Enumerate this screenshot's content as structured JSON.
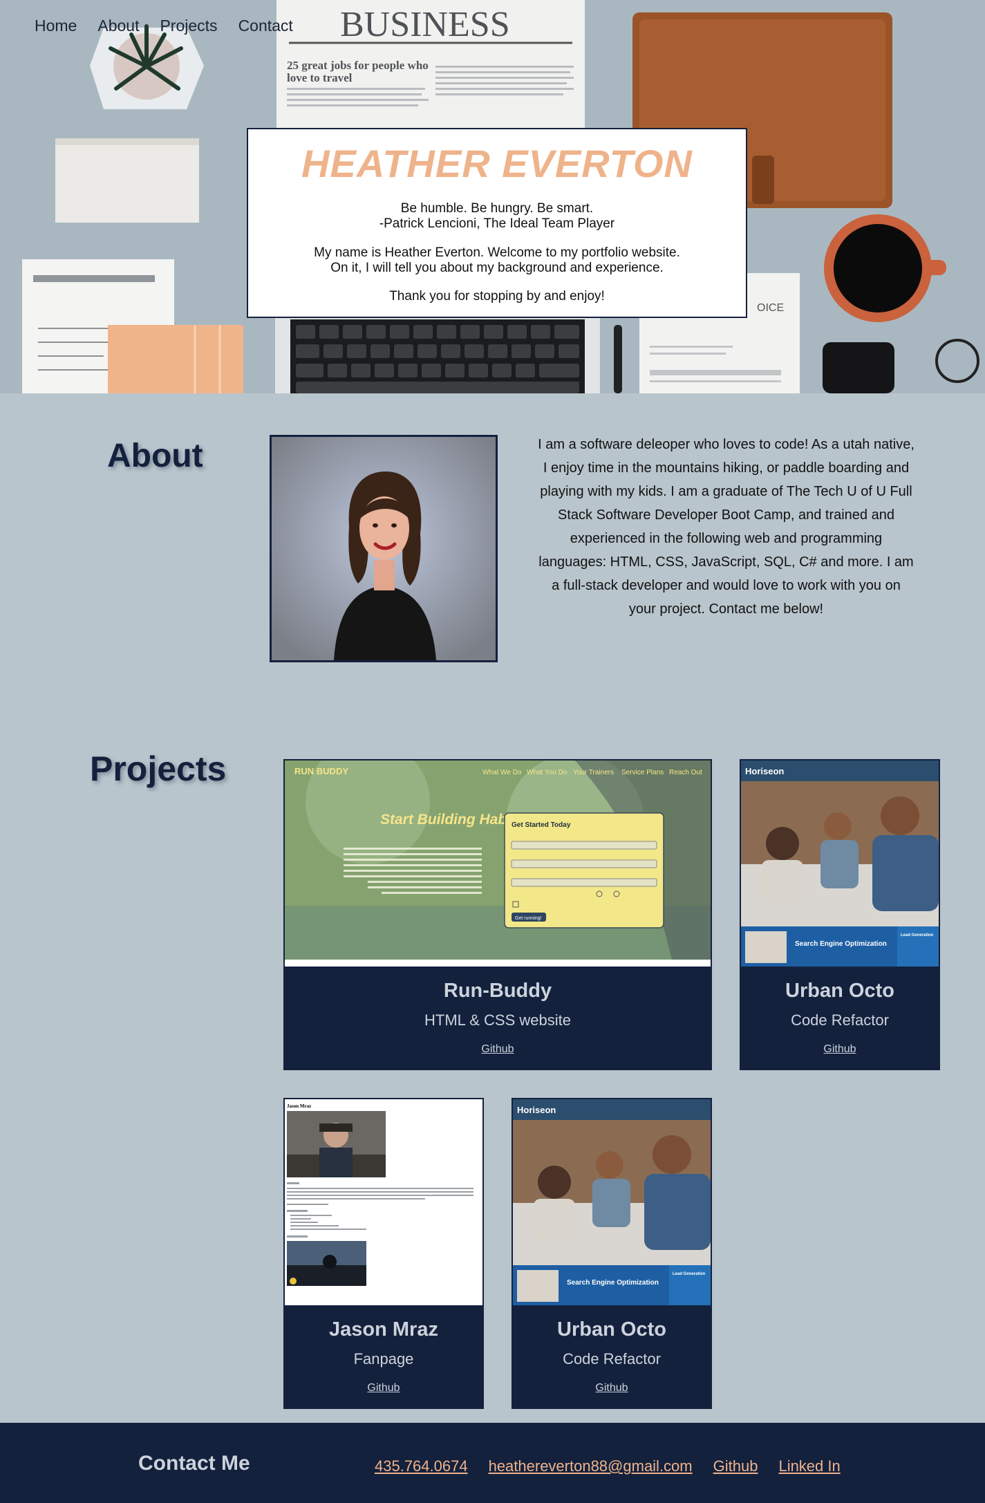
{
  "nav": {
    "items": [
      "Home",
      "About",
      "Projects",
      "Contact"
    ]
  },
  "hero": {
    "newspaper_masthead": "BUSINESS",
    "newspaper_headline": "25 great jobs for people who love to travel",
    "name": "HEATHER EVERTON",
    "quote_line1": "Be humble. Be hungry. Be smart.",
    "quote_line2": "-Patrick Lencioni, The Ideal Team Player",
    "intro_line1": "My name is Heather Everton. Welcome to my portfolio website.",
    "intro_line2": "On it, I will tell you about my background and experience.",
    "thanks": "Thank you for stopping by and enjoy!"
  },
  "about": {
    "heading": "About",
    "text": "I am a software deleoper who loves to code! As a utah native, I enjoy time in the mountains hiking, or paddle boarding and playing with my kids. I am a graduate of The Tech U of U Full Stack Software Developer Boot Camp, and trained and experienced in the following web and programming languages: HTML, CSS, JavaScript, SQL, C# and more. I am a full-stack developer and would love to work with you on your project. Contact me below!"
  },
  "projects": {
    "heading": "Projects",
    "items": [
      {
        "title": "Run-Buddy",
        "subtitle": "HTML & CSS website",
        "link": "Github",
        "shot": {
          "brand": "RUN BUDDY",
          "nav": [
            "What We Do",
            "What You Do",
            "Your Trainers",
            "Service Plans",
            "Reach Out"
          ],
          "headline": "Start Building Habits.",
          "form_title": "Get Started Today",
          "form_button": "Get running!"
        }
      },
      {
        "title": "Urban Octo",
        "subtitle": "Code Refactor",
        "link": "Github",
        "shot": {
          "brand": "Horiseon",
          "banner": "Search Engine Optimization",
          "side": "Lead Generation"
        }
      },
      {
        "title": "Jason Mraz",
        "subtitle": "Fanpage",
        "link": "Github",
        "shot": {
          "brand": "Jason Mraz"
        }
      },
      {
        "title": "Urban Octo",
        "subtitle": "Code Refactor",
        "link": "Github",
        "shot": {
          "brand": "Horiseon",
          "banner": "Search Engine Optimization",
          "side": "Lead Generation"
        }
      }
    ]
  },
  "contact": {
    "heading": "Contact Me",
    "phone": "435.764.0674",
    "email": "heathereverton88@gmail.com",
    "github": "Github",
    "linkedin": "Linked In"
  },
  "colors": {
    "navy": "#14213d",
    "peach": "#efb38b",
    "background": "#b9c5cc",
    "card_text": "#ccd3dc"
  }
}
